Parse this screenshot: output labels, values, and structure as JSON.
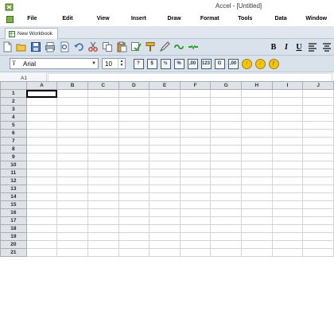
{
  "window": {
    "title": "Accel - [Untitled]"
  },
  "menu": [
    {
      "label": "File"
    },
    {
      "label": "Edit"
    },
    {
      "label": "View"
    },
    {
      "label": "Insert"
    },
    {
      "label": "Draw"
    },
    {
      "label": "Format"
    },
    {
      "label": "Tools"
    },
    {
      "label": "Data"
    },
    {
      "label": "Window"
    }
  ],
  "tabs": [
    {
      "label": "New Workbook"
    }
  ],
  "toolbar": {
    "icons": [
      "new-icon",
      "open-icon",
      "save-icon",
      "print-icon",
      "print-preview-icon",
      "undo-icon",
      "cut-icon",
      "copy-icon",
      "paste-icon",
      "spellcheck-icon",
      "format-painter-icon",
      "draw-icon",
      "link-icon",
      "link-break-icon"
    ],
    "bold_label": "B",
    "italic_label": "I",
    "underline_label": "U"
  },
  "format_bar": {
    "font_name": "Arial",
    "font_size": "10",
    "number_buttons": [
      {
        "name": "help-icon",
        "label": "?"
      },
      {
        "name": "currency-icon",
        "label": "$"
      },
      {
        "name": "fraction-icon",
        "label": "½"
      },
      {
        "name": "percent-icon",
        "label": "%"
      },
      {
        "name": "thousands-icon",
        "label": ",00"
      },
      {
        "name": "number-icon",
        "label": "123"
      },
      {
        "name": "general-icon",
        "label": "G"
      },
      {
        "name": "decimal-icon",
        "label": ",00"
      }
    ]
  },
  "formula_bar": {
    "cell_ref": "A1",
    "value": ""
  },
  "grid": {
    "columns": [
      "A",
      "B",
      "C",
      "D",
      "E",
      "F",
      "G",
      "H",
      "I",
      "J"
    ],
    "rows": [
      "1",
      "2",
      "3",
      "4",
      "5",
      "6",
      "7",
      "8",
      "9",
      "10",
      "11",
      "12",
      "13",
      "14",
      "15",
      "16",
      "17",
      "18",
      "19",
      "20",
      "21"
    ],
    "active_cell": "A1"
  },
  "colors": {
    "toolbar_bg": "#d9e1ea",
    "header_bg": "#dfe3e8",
    "grid_line": "#d4d4d4"
  }
}
